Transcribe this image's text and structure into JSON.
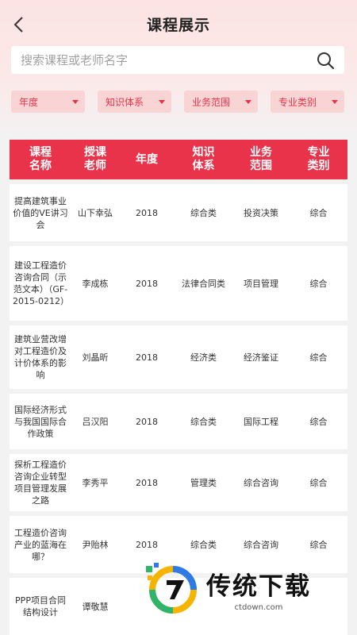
{
  "header": {
    "title": "课程展示"
  },
  "search": {
    "placeholder": "搜索课程或老师名字"
  },
  "filters": [
    {
      "label": "年度"
    },
    {
      "label": "知识体系"
    },
    {
      "label": "业务范围"
    },
    {
      "label": "专业类别"
    }
  ],
  "table": {
    "headers": [
      "课程\n名称",
      "授课\n老师",
      "年度",
      "知识\n体系",
      "业务\n范围",
      "专业\n类别"
    ],
    "rows": [
      [
        "提高建筑事业价值的VE讲习会",
        "山下幸弘",
        "2018",
        "综合类",
        "投资决策",
        "综合"
      ],
      [
        "建设工程造价咨询合同（示范文本）（GF-2015-0212）",
        "李成栋",
        "2018",
        "法律合同类",
        "项目管理",
        "综合"
      ],
      [
        "建筑业营改增对工程造价及计价体系的影响",
        "刘晶昕",
        "2018",
        "经济类",
        "经济鉴证",
        "综合"
      ],
      [
        "国际经济形式与我国国际合作政策",
        "吕汉阳",
        "2018",
        "综合类",
        "国际工程",
        "综合"
      ],
      [
        "探析工程造价咨询企业转型项目管理发展之路",
        "李秀平",
        "2018",
        "管理类",
        "综合咨询",
        "综合"
      ],
      [
        "工程造价咨询产业的蓝海在哪？",
        "尹贻林",
        "2018",
        "综合类",
        "综合咨询",
        "综合"
      ],
      [
        "PPP项目合同结构设计",
        "谭敬慧",
        "",
        "",
        "",
        ""
      ]
    ]
  },
  "watermark": {
    "title": "传统下载",
    "url": "ctdown.com"
  },
  "colors": {
    "accent": "#e8334a",
    "filter_bg": "#f8d4d4"
  }
}
